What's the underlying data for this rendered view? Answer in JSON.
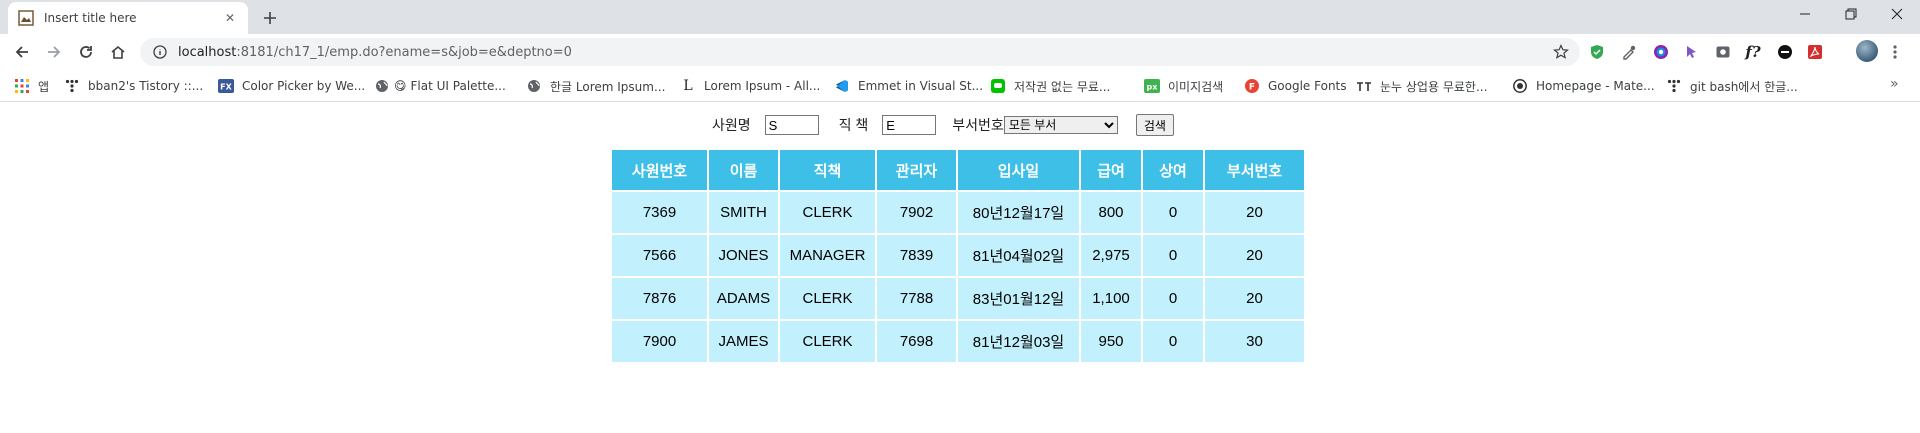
{
  "browser": {
    "tab": {
      "title": "Insert title here"
    },
    "address": {
      "host": "localhost",
      "path": ":8181/ch17_1/emp.do?ename=s&job=e&deptno=0"
    },
    "bookmarks": [
      {
        "label": "앱",
        "icon": "apps-grid-icon"
      },
      {
        "label": "bban2's Tistory ::...",
        "icon": "tistory-icon"
      },
      {
        "label": "Color Picker by We...",
        "icon": "fx-icon"
      },
      {
        "label": "Flat UI Palette...",
        "icon": "globe-icon"
      },
      {
        "label": "한글 Lorem Ipsum...",
        "icon": "globe-icon"
      },
      {
        "label": "Lorem Ipsum - All...",
        "icon": "lorem-l-icon"
      },
      {
        "label": "Emmet in Visual St...",
        "icon": "vscode-icon"
      },
      {
        "label": "저작권 없는 무료...",
        "icon": "chat-icon"
      },
      {
        "label": "이미지검색",
        "icon": "px-icon"
      },
      {
        "label": "Google Fonts",
        "icon": "google-fonts-icon"
      },
      {
        "label": "눈누 상업용 무료한...",
        "icon": "noonnu-icon"
      },
      {
        "label": "Homepage - Mate...",
        "icon": "material-icon"
      },
      {
        "label": "git bash에서 한글...",
        "icon": "tistory-icon"
      }
    ]
  },
  "search": {
    "name_label": "사원명",
    "name_value": "S",
    "job_label": "직 책",
    "job_value": "E",
    "dept_label": "부서번호",
    "dept_selected": "모든 부서",
    "submit_label": "검색"
  },
  "table": {
    "headers": [
      "사원번호",
      "이름",
      "직책",
      "관리자",
      "입사일",
      "급여",
      "상여",
      "부서번호"
    ],
    "rows": [
      [
        "7369",
        "SMITH",
        "CLERK",
        "7902",
        "80년12월17일",
        "800",
        "0",
        "20"
      ],
      [
        "7566",
        "JONES",
        "MANAGER",
        "7839",
        "81년04월02일",
        "2,975",
        "0",
        "20"
      ],
      [
        "7876",
        "ADAMS",
        "CLERK",
        "7788",
        "83년01월12일",
        "1,100",
        "0",
        "20"
      ],
      [
        "7900",
        "JAMES",
        "CLERK",
        "7698",
        "81년12월03일",
        "950",
        "0",
        "30"
      ]
    ]
  },
  "colors": {
    "header_bg": "#3ebfe7",
    "cell_bg": "#c2f0fc"
  }
}
